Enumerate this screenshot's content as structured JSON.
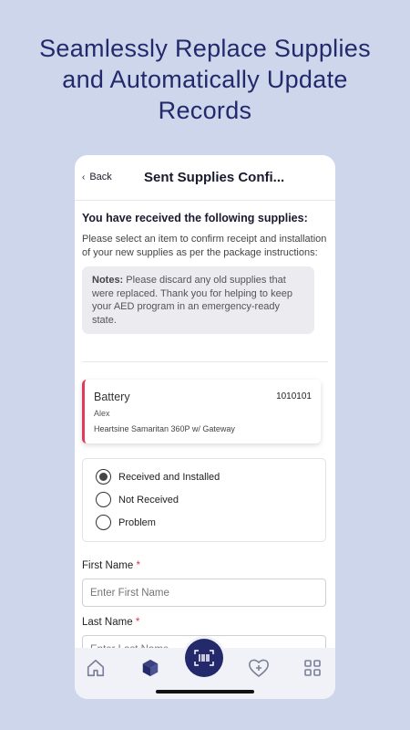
{
  "headline": {
    "line1": "Seamlessly Replace Supplies",
    "line2": "and Automatically Update",
    "line3": "Records"
  },
  "header": {
    "back_label": "Back",
    "title": "Sent Supplies Confi..."
  },
  "intro": {
    "title": "You have received the following supplies:",
    "text": "Please select an item to confirm receipt and installation of your new supplies as per the package instructions:",
    "notes_label": "Notes:",
    "notes_text": "Please discard any old supplies that were replaced. Thank you for helping to keep your AED program in an emergency-ready state."
  },
  "item": {
    "name": "Battery",
    "id": "1010101",
    "user": "Alex",
    "model": "Heartsine Samaritan 360P w/ Gateway"
  },
  "status_options": [
    {
      "label": "Received and Installed",
      "selected": true
    },
    {
      "label": "Not Received",
      "selected": false
    },
    {
      "label": "Problem",
      "selected": false
    }
  ],
  "form": {
    "first_name_label": "First Name",
    "first_name_placeholder": "Enter First Name",
    "last_name_label": "Last Name",
    "last_name_placeholder": "Enter Last Name",
    "required_marker": "*"
  },
  "tabs": [
    {
      "icon": "home-icon"
    },
    {
      "icon": "package-icon"
    },
    {
      "icon": "barcode-scan-icon"
    },
    {
      "icon": "heart-plus-icon"
    },
    {
      "icon": "grid-icon"
    }
  ],
  "colors": {
    "accent": "#23296b",
    "required": "#d9344f",
    "card_stripe": "#e03b5a",
    "background": "#cdd6ea"
  }
}
